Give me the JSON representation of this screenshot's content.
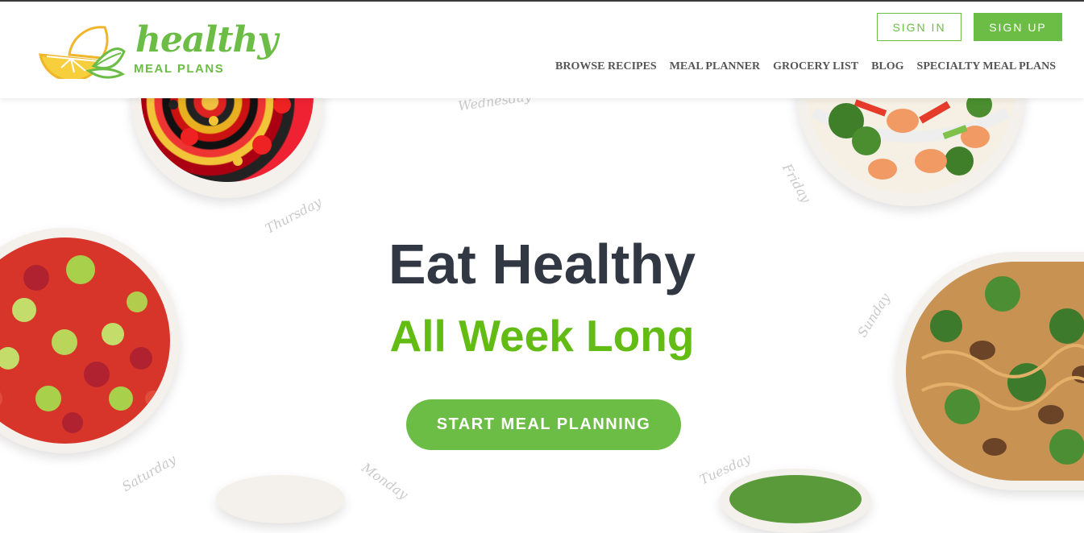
{
  "header": {
    "logo": {
      "word": "healthy",
      "sub": "MEAL PLANS"
    },
    "sign_in": "SIGN IN",
    "sign_up": "SIGN UP",
    "nav": [
      "BROWSE RECIPES",
      "MEAL PLANNER",
      "GROCERY LIST",
      "BLOG",
      "SPECIALTY MEAL PLANS"
    ]
  },
  "hero": {
    "title": "Eat Healthy",
    "subtitle": "All Week Long",
    "cta": "START MEAL PLANNING"
  },
  "days": [
    "Wednesday",
    "Thursday",
    "Friday",
    "Sunday",
    "Saturday",
    "Monday",
    "Tuesday"
  ],
  "colors": {
    "accent": "#6cbd45",
    "heading": "#323843",
    "subtitle": "#62bc14"
  }
}
